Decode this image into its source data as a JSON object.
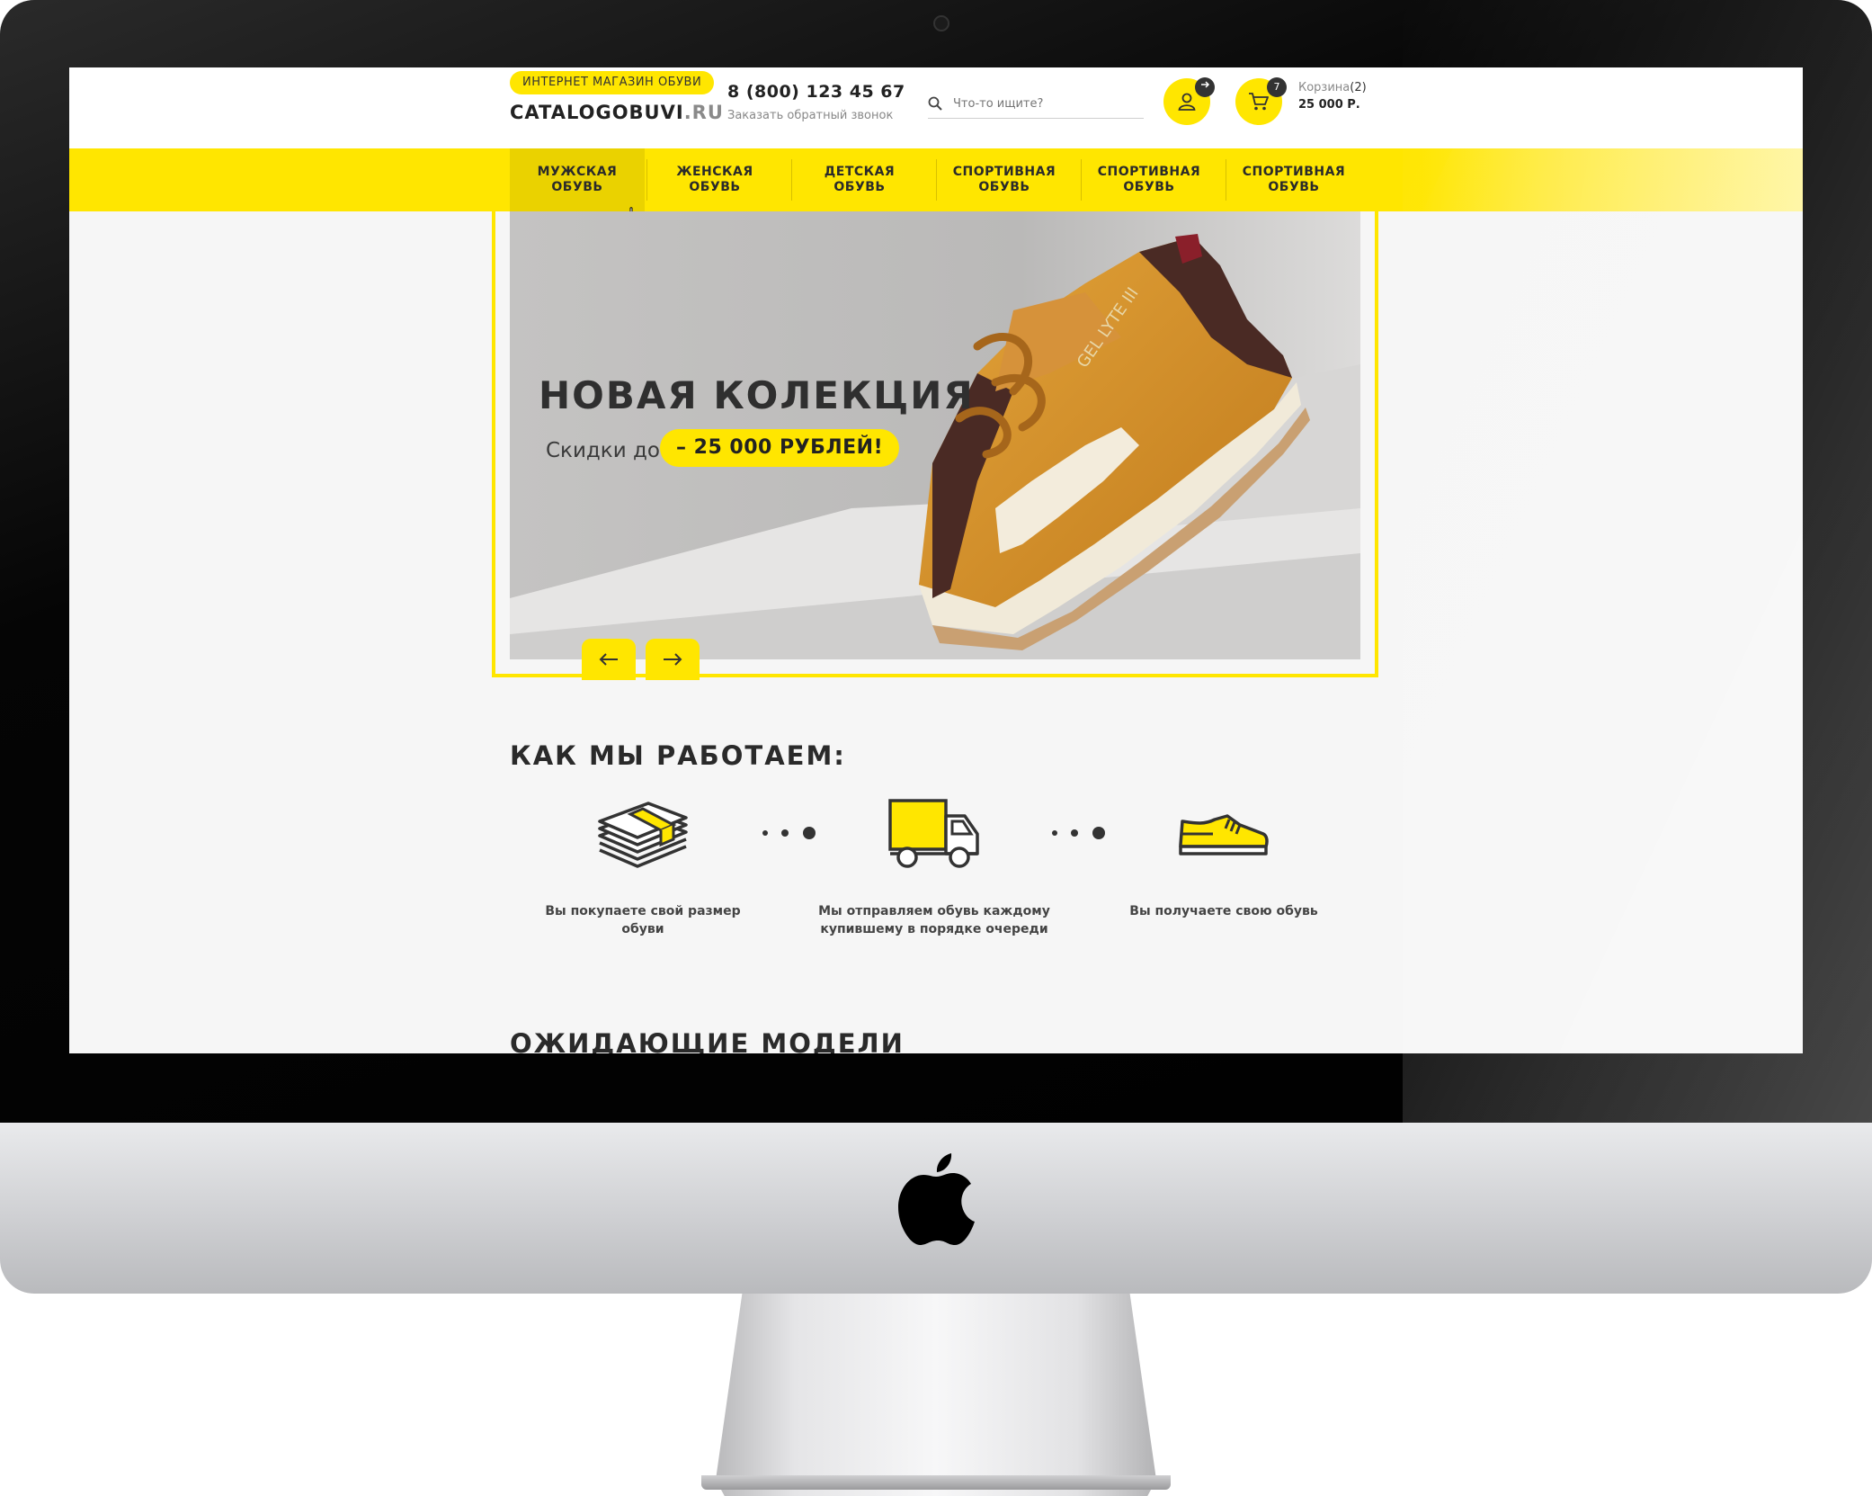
{
  "header": {
    "tagline": "ИНТЕРНЕТ МАГАЗИН ОБУВИ",
    "logo_main": "CATALOGOBUVI",
    "logo_domain": ".RU",
    "phone": "8 (800) 123 45 67",
    "callback": "Заказать обратный звонок",
    "search_placeholder": "Что-то ищите?",
    "cart_badge": "7",
    "cart_label": "Корзина",
    "cart_count": "(2)",
    "cart_sum": "25 000 Р."
  },
  "nav": {
    "items": [
      {
        "label": "МУЖСКАЯ\nОБУВЬ",
        "active": true
      },
      {
        "label": "ЖЕНСКАЯ\nОБУВЬ",
        "active": false
      },
      {
        "label": "ДЕТСКАЯ\nОБУВЬ",
        "active": false
      },
      {
        "label": "СПОРТИВНАЯ\nОБУВЬ",
        "active": false
      },
      {
        "label": "СПОРТИВНАЯ\nОБУВЬ",
        "active": false
      },
      {
        "label": "СПОРТИВНАЯ\nОБУВЬ",
        "active": false
      }
    ]
  },
  "hero": {
    "title": "НОВАЯ КОЛЕКЦИЯ",
    "subtitle": "Скидки до",
    "discount": "– 25 000 РУБЛЕЙ!",
    "shoe_text": "GEL LYTE III"
  },
  "how": {
    "title": "КАК МЫ РАБОТАЕМ:",
    "steps": [
      {
        "icon": "money-stack-icon",
        "text": "Вы покупаете свой размер обуви"
      },
      {
        "icon": "delivery-truck-icon",
        "text": "Мы отправляем обувь каждому купившему в порядке очереди"
      },
      {
        "icon": "sneaker-icon",
        "text": "Вы получаете свою обувь"
      }
    ]
  },
  "next_section": {
    "title": "ОЖИДАЮЩИЕ МОДЕЛИ"
  },
  "colors": {
    "accent": "#ffe600",
    "dark": "#2a2a2a"
  }
}
